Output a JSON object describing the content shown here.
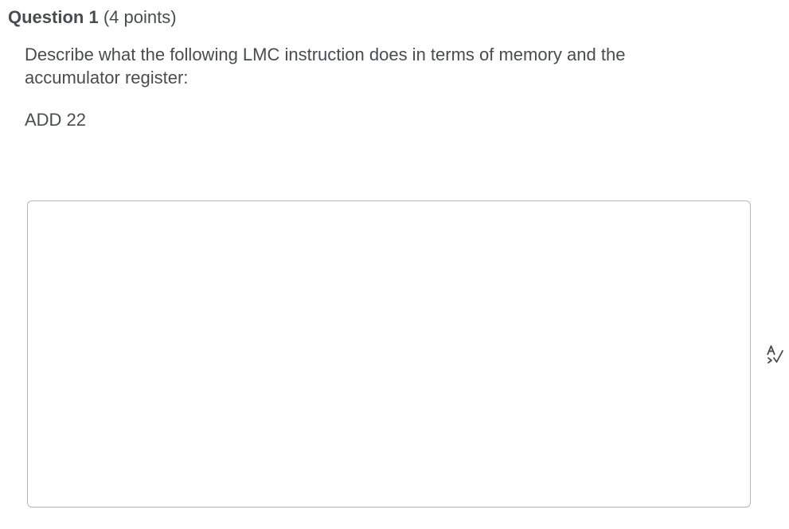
{
  "question": {
    "title": "Question 1",
    "points": "(4 points)"
  },
  "prompt": {
    "line1": "Describe what the following LMC instruction does in terms of memory and the",
    "line2": "accumulator register:"
  },
  "instruction": "ADD 22",
  "answer": {
    "value": "",
    "placeholder": ""
  },
  "icons": {
    "spellcheck": "spellcheck-icon"
  },
  "colors": {
    "text": "#494c4e",
    "border": "#b5b5b5",
    "background": "#ffffff"
  }
}
